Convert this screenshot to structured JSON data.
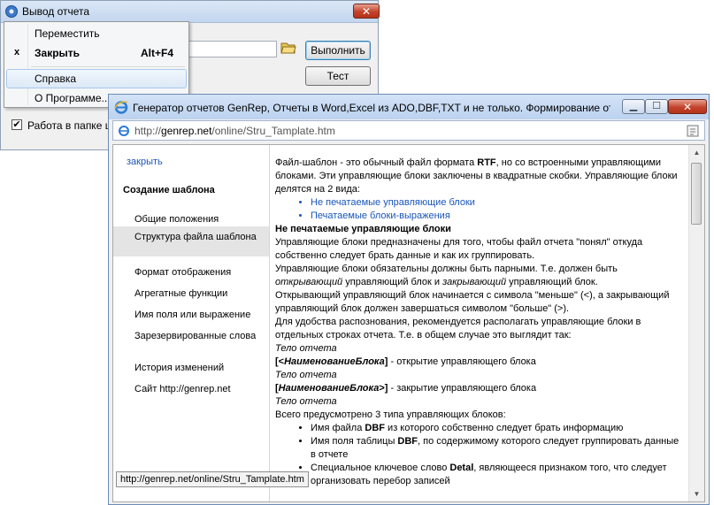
{
  "dialog": {
    "title": "Вывод отчета",
    "run_button": "Выполнить",
    "test_button": "Тест",
    "checkbox_label": "Работа в папке ш",
    "checkbox_checked": "✔"
  },
  "system_menu": {
    "move": "Переместить",
    "close": "Закрыть",
    "close_shortcut": "Alt+F4",
    "close_mark": "x",
    "help": "Справка",
    "about": "О Программе..."
  },
  "browser": {
    "title": "Генератор отчетов GenRep, Отчеты в Word,Excel из ADO,DBF,TXT и не только. Формирование от...",
    "url_prefix": "http://",
    "url_host": "genrep.net",
    "url_path": "/online/Stru_Tamplate.htm",
    "status_url": "http://genrep.net/online/Stru_Tamplate.htm"
  },
  "sidebar": {
    "close_link": "закрыть",
    "section_title": "Создание шаблона",
    "items": [
      "Общие положения",
      "Структура файла шаблона",
      "Формат отображения",
      "Агрегатные функции",
      "Имя поля или выражение",
      "Зарезервированные слова",
      "Иcтория изменений",
      "Сайт http://genrep.net"
    ]
  },
  "article": {
    "p1a": "Файл-шаблон - это обычный файл формата ",
    "p1b": "RTF",
    "p1c": ", но со встроенными управляющими блоками. Эти управляющие блоки заключены в квадратные скобки. Управляющие блоки делятся на 2 вида:",
    "link1": "Не печатаемые управляющие блоки",
    "link2": "Печатаемые блоки-выражения",
    "h1": "Не печатаемые управляющие блоки",
    "p2": "Управляющие блоки предназначены для того, чтобы файл отчета \"понял\" откуда собственно следует брать данные и как их группировать.",
    "p3a": "Управляющие блоки обязательны должны быть парными. Т.е. должен быть ",
    "p3b": "открывающий",
    "p3c": " управляющий блок и ",
    "p3d": "закрывающий",
    "p3e": " управляющий блок.",
    "p4": "Открывающий управляющий блок начинается с символа \"меньше\" (<), а закрывающий управляющий блок должен завершаться символом \"больше\" (>).",
    "p5": "Для удобства распознования, рекомендуется располагать управляющие блоки в отдельных строках отчета. Т.е. в общем случае это выглядит так:",
    "body1": "Тело отчета",
    "open_a": "[<",
    "open_b": "НаименованиеБлока",
    "open_c": "]",
    "open_d": " - открытие управляющего блока",
    "body2": "Тело отчета",
    "close_a": "[",
    "close_b": "НаименованиеБлока",
    "close_c": ">]",
    "close_d": " - закрытие управляющего блока",
    "body3": "Тело отчета",
    "p6": "Всего предусмотрено 3 типа управляющих блоков:",
    "li1a": "Имя файла ",
    "li1b": "DBF",
    "li1c": " из которого собственно следует брать информацию",
    "li2a": "Имя поля таблицы ",
    "li2b": "DBF",
    "li2c": ", по содержимому которого следует группировать данные в отчете",
    "li3a": "Специальное ключевое слово ",
    "li3b": "Detal",
    "li3c": ", являющееся признаком того, что следует организовать перебор записей"
  },
  "icons": {
    "app": "gear-icon",
    "folder": "folder-open-icon",
    "ie": "ie-icon",
    "page": "page-icon",
    "compat": "compat-view-icon"
  }
}
